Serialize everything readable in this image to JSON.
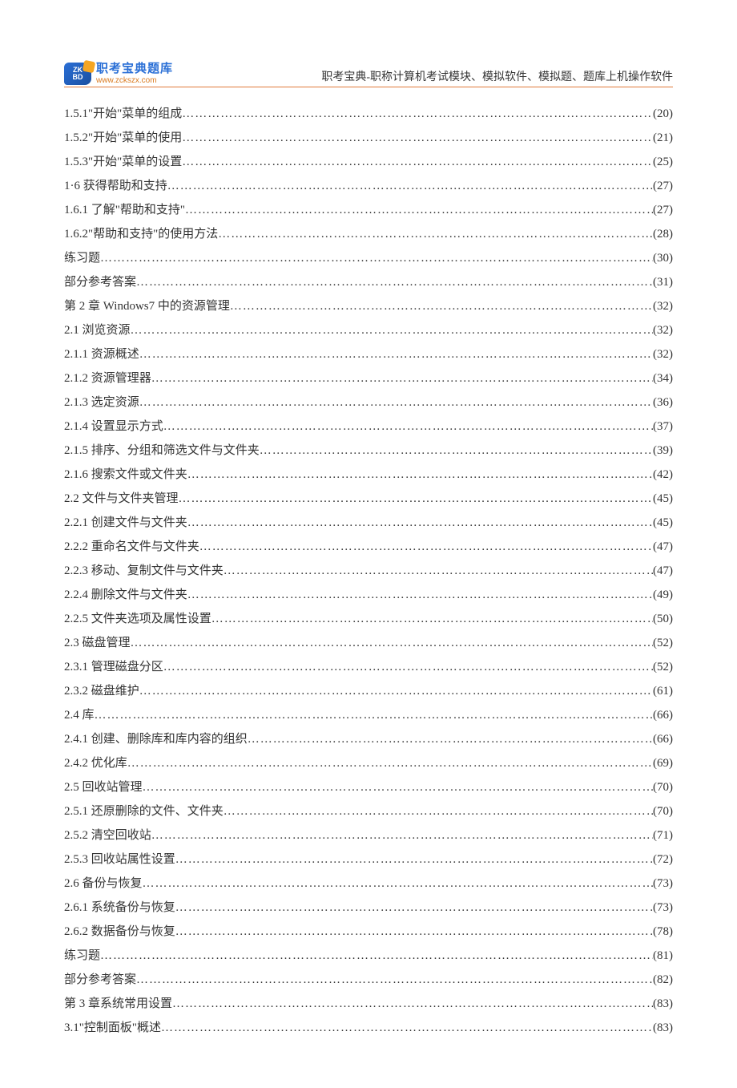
{
  "logo": {
    "badge_line1": "ZK",
    "badge_line2": "BD",
    "cn": "职考宝典题库",
    "url": "www.zckszx.com"
  },
  "header_title": "职考宝典-职称计算机考试模块、模拟软件、模拟题、题库上机操作软件",
  "toc": [
    {
      "label": "1.5.1\"开始\"菜单的组成",
      "page": "(20)"
    },
    {
      "label": "1.5.2\"开始\"菜单的使用",
      "page": "(21)"
    },
    {
      "label": "1.5.3\"开始\"菜单的设置",
      "page": "(25)"
    },
    {
      "label": "1·6 获得帮助和支持",
      "page": "(27)"
    },
    {
      "label": "1.6.1 了解\"帮助和支持\"",
      "page": "(27)"
    },
    {
      "label": "1.6.2\"帮助和支持\"的使用方法",
      "page": "(28)"
    },
    {
      "label": "练习题",
      "page": "(30)"
    },
    {
      "label": "部分参考答案",
      "page": "(31)"
    },
    {
      "label": "第 2 章 Windows7 中的资源管理",
      "page": "(32)"
    },
    {
      "label": "2.1 浏览资源",
      "page": "(32)"
    },
    {
      "label": "2.1.1 资源概述",
      "page": "(32)"
    },
    {
      "label": "2.1.2 资源管理器",
      "page": "(34)"
    },
    {
      "label": "2.1.3 选定资源",
      "page": "(36)"
    },
    {
      "label": "2.1.4 设置显示方式",
      "page": "(37)"
    },
    {
      "label": "2.1.5 排序、分组和筛选文件与文件夹",
      "page": "(39)"
    },
    {
      "label": "2.1.6 搜索文件或文件夹",
      "page": "(42)"
    },
    {
      "label": "2.2 文件与文件夹管理",
      "page": "(45)"
    },
    {
      "label": "2.2.1 创建文件与文件夹",
      "page": "(45)"
    },
    {
      "label": "2.2.2 重命名文件与文件夹",
      "page": "(47)"
    },
    {
      "label": "2.2.3 移动、复制文件与文件夹",
      "page": "(47)"
    },
    {
      "label": "2.2.4 删除文件与文件夹",
      "page": "(49)"
    },
    {
      "label": "2.2.5 文件夹选项及属性设置",
      "page": "(50)"
    },
    {
      "label": "2.3 磁盘管理",
      "page": "(52)"
    },
    {
      "label": "2.3.1 管理磁盘分区",
      "page": "(52)"
    },
    {
      "label": "2.3.2 磁盘维护",
      "page": "(61)"
    },
    {
      "label": "2.4 库",
      "page": "(66)"
    },
    {
      "label": "2.4.1 创建、删除库和库内容的组织",
      "page": "(66)"
    },
    {
      "label": "2.4.2 优化库",
      "page": "(69)"
    },
    {
      "label": "2.5 回收站管理",
      "page": "(70)"
    },
    {
      "label": "2.5.1 还原删除的文件、文件夹",
      "page": "(70)"
    },
    {
      "label": "2.5.2 清空回收站",
      "page": "(71)"
    },
    {
      "label": "2.5.3 回收站属性设置",
      "page": "(72)"
    },
    {
      "label": "2.6 备份与恢复",
      "page": "(73)"
    },
    {
      "label": "2.6.1 系统备份与恢复",
      "page": "(73)"
    },
    {
      "label": "2.6.2 数据备份与恢复",
      "page": "(78)"
    },
    {
      "label": "练习题",
      "page": "(81)"
    },
    {
      "label": "部分参考答案",
      "page": "(82)"
    },
    {
      "label": "第 3 章系统常用设置",
      "page": "(83)"
    },
    {
      "label": "3.1\"控制面板\"概述",
      "page": "(83)"
    }
  ]
}
